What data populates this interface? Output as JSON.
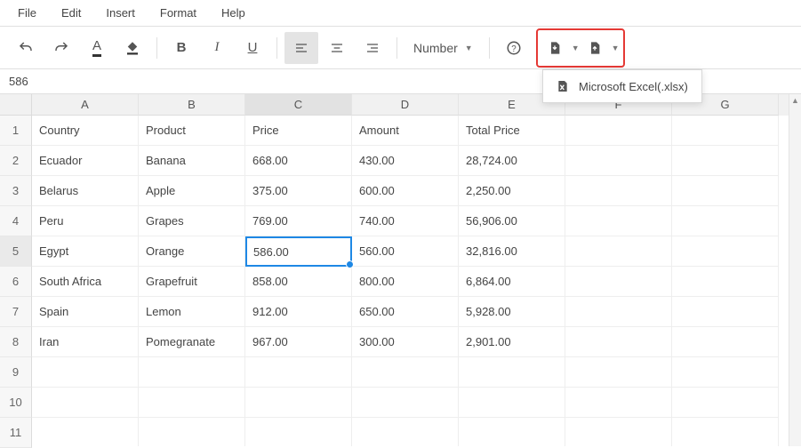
{
  "menu": {
    "items": [
      "File",
      "Edit",
      "Insert",
      "Format",
      "Help"
    ]
  },
  "toolbar": {
    "number_label": "Number"
  },
  "formula_bar": {
    "value": "586"
  },
  "dropdown": {
    "export_xlsx": "Microsoft Excel(.xlsx)"
  },
  "columns": [
    "A",
    "B",
    "C",
    "D",
    "E",
    "F",
    "G"
  ],
  "row_numbers": [
    "1",
    "2",
    "3",
    "4",
    "5",
    "6",
    "7",
    "8",
    "9",
    "10",
    "11"
  ],
  "selected": {
    "row": 5,
    "col": "C"
  },
  "grid": [
    {
      "A": "Country",
      "B": "Product",
      "C": "Price",
      "D": "Amount",
      "E": "Total Price",
      "F": "",
      "G": ""
    },
    {
      "A": "Ecuador",
      "B": "Banana",
      "C": "668.00",
      "D": "430.00",
      "E": "28,724.00",
      "F": "",
      "G": ""
    },
    {
      "A": "Belarus",
      "B": "Apple",
      "C": "375.00",
      "D": "600.00",
      "E": "2,250.00",
      "F": "",
      "G": ""
    },
    {
      "A": "Peru",
      "B": "Grapes",
      "C": "769.00",
      "D": "740.00",
      "E": "56,906.00",
      "F": "",
      "G": ""
    },
    {
      "A": "Egypt",
      "B": "Orange",
      "C": "586.00",
      "D": "560.00",
      "E": "32,816.00",
      "F": "",
      "G": ""
    },
    {
      "A": "South Africa",
      "B": "Grapefruit",
      "C": "858.00",
      "D": "800.00",
      "E": "6,864.00",
      "F": "",
      "G": ""
    },
    {
      "A": "Spain",
      "B": "Lemon",
      "C": "912.00",
      "D": "650.00",
      "E": "5,928.00",
      "F": "",
      "G": ""
    },
    {
      "A": "Iran",
      "B": "Pomegranate",
      "C": "967.00",
      "D": "300.00",
      "E": "2,901.00",
      "F": "",
      "G": ""
    },
    {
      "A": "",
      "B": "",
      "C": "",
      "D": "",
      "E": "",
      "F": "",
      "G": ""
    },
    {
      "A": "",
      "B": "",
      "C": "",
      "D": "",
      "E": "",
      "F": "",
      "G": ""
    },
    {
      "A": "",
      "B": "",
      "C": "",
      "D": "",
      "E": "",
      "F": "",
      "G": ""
    }
  ]
}
